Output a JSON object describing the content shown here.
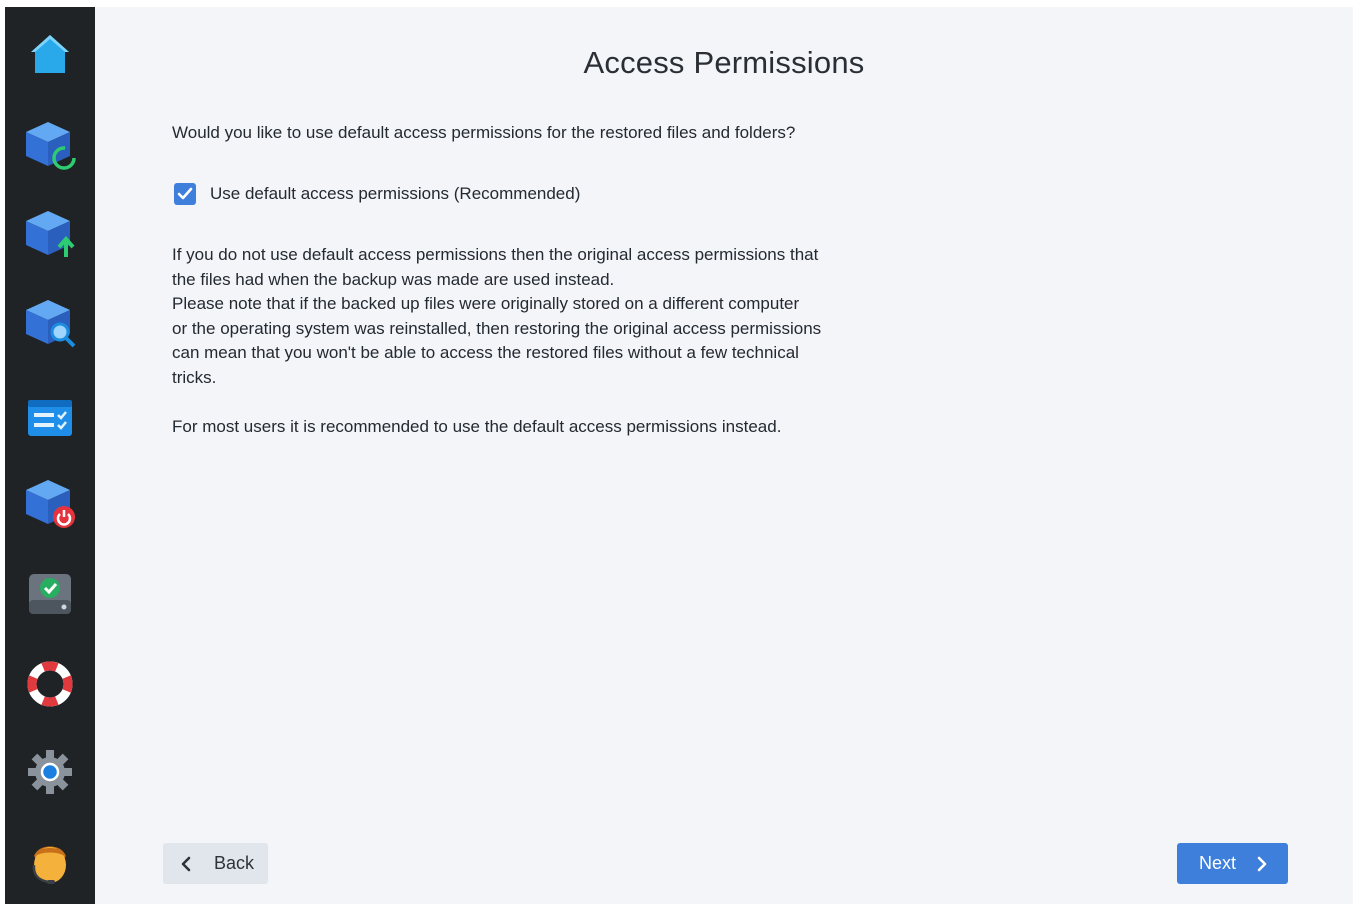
{
  "sidebar": {
    "items": [
      {
        "name": "home-icon"
      },
      {
        "name": "restore-icon"
      },
      {
        "name": "backup-icon"
      },
      {
        "name": "explore-icon"
      },
      {
        "name": "tasks-icon"
      },
      {
        "name": "shutdown-icon"
      },
      {
        "name": "disk-check-icon"
      },
      {
        "name": "help-icon"
      },
      {
        "name": "settings-icon"
      },
      {
        "name": "user-avatar-icon"
      }
    ]
  },
  "page": {
    "title": "Access Permissions",
    "question": "Would you like to use default access permissions for the restored files and folders?",
    "checkbox": {
      "label": "Use default access permissions (Recommended)",
      "checked": true
    },
    "explanation": [
      "If you do not use default access permissions then the original access permissions that",
      "the files had when the backup was made are used instead.",
      "Please note that if the backed up files were originally stored on a different computer",
      "or the operating system was reinstalled, then restoring the original access permissions",
      "can mean that you won't be able to access the restored files without a few technical",
      "tricks."
    ],
    "recommendation": "For most users it is recommended to use the default access permissions instead."
  },
  "buttons": {
    "back_label": "Back",
    "next_label": "Next"
  },
  "colors": {
    "accent": "#3f7fdc",
    "sidebar_bg": "#1f2326",
    "content_bg": "#f3f5f9"
  }
}
